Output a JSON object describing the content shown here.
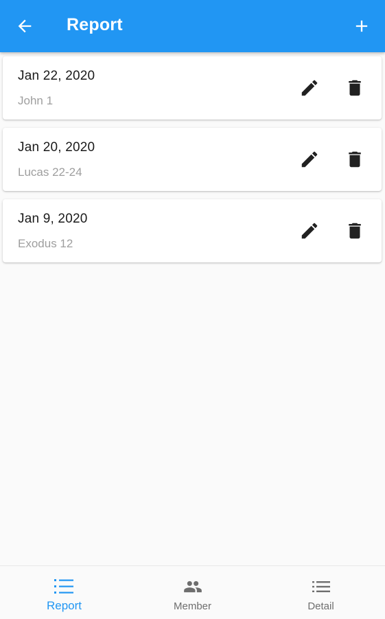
{
  "appbar": {
    "title": "Report",
    "back_icon": "arrow-back-icon",
    "add_icon": "add-icon",
    "color": "#2196f3"
  },
  "reports": [
    {
      "date": "Jan 22, 2020",
      "reference": "John 1"
    },
    {
      "date": "Jan 20, 2020",
      "reference": "Lucas 22-24"
    },
    {
      "date": "Jan 9, 2020",
      "reference": "Exodus 12"
    }
  ],
  "bottom_nav": {
    "active_color": "#2196f3",
    "items": [
      {
        "label": "Report",
        "icon": "numbered-list-icon",
        "active": true
      },
      {
        "label": "Member",
        "icon": "people-icon",
        "active": false
      },
      {
        "label": "Detail",
        "icon": "list-icon",
        "active": false
      }
    ]
  }
}
